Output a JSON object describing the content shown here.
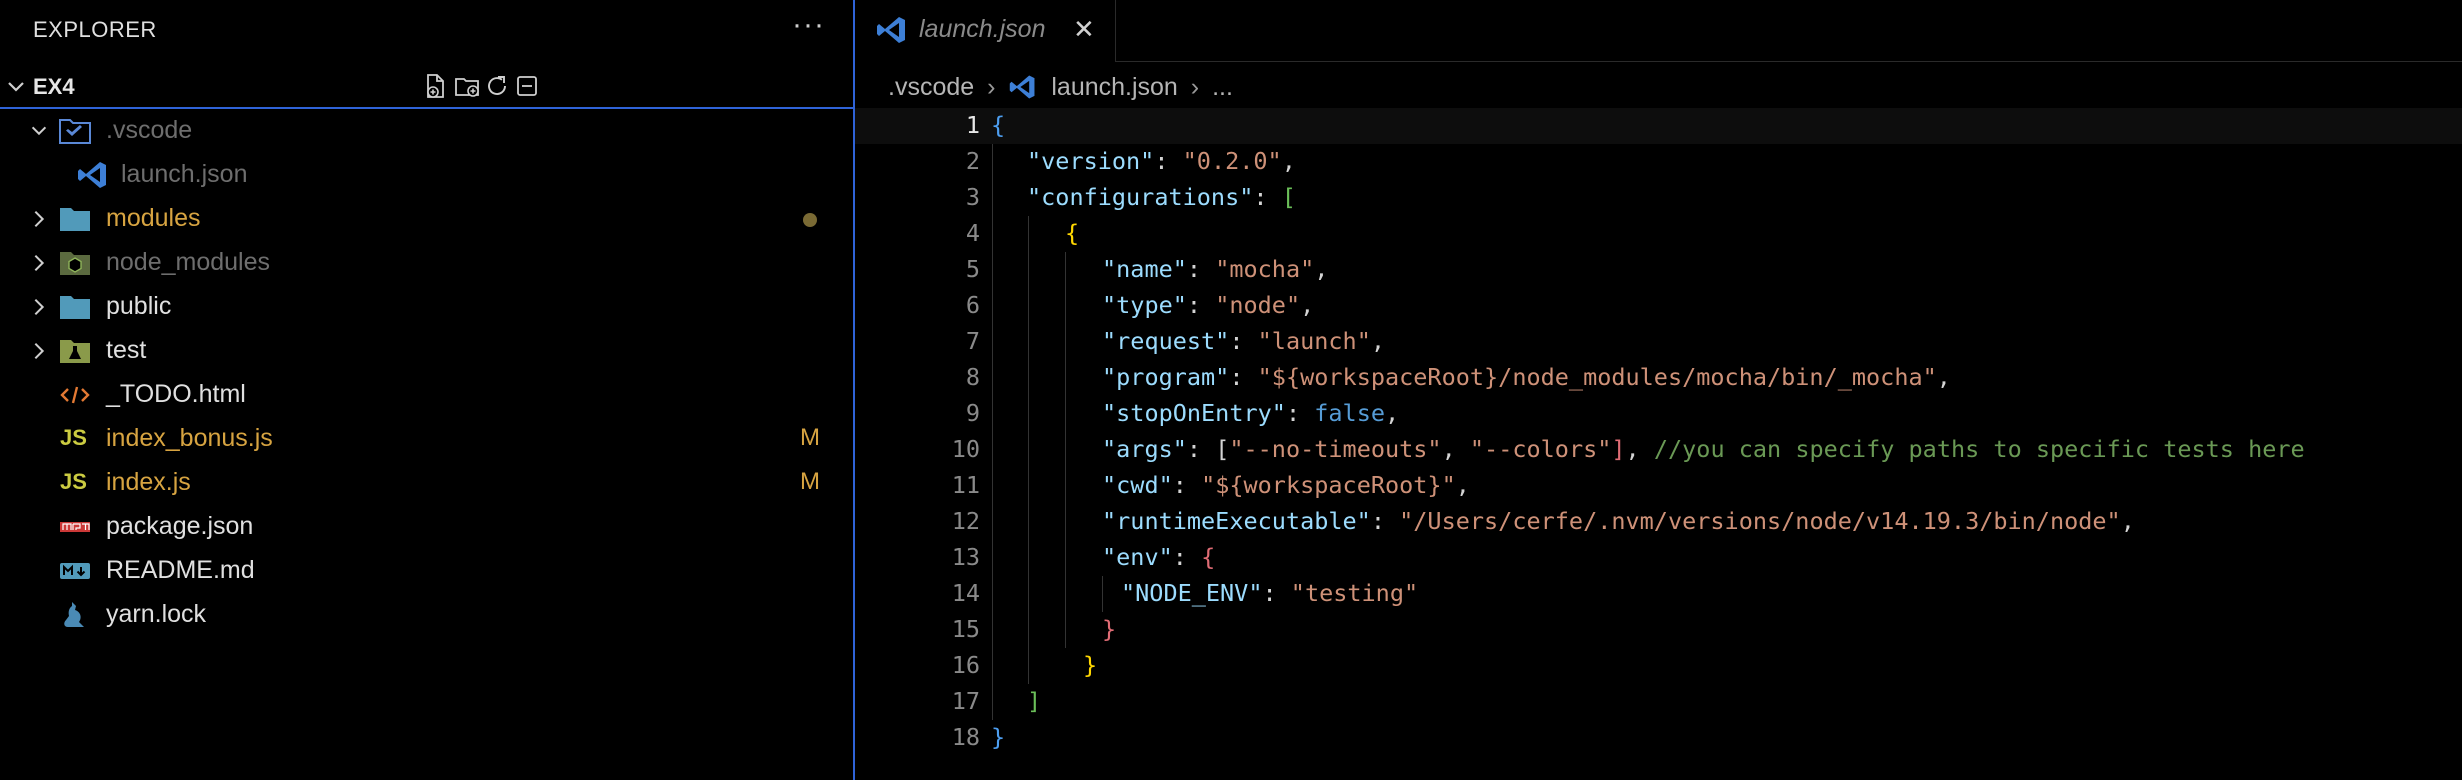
{
  "explorer": {
    "title": "EXPLORER",
    "more": "···",
    "workspace": "EX4",
    "items": [
      {
        "label": "launch.json",
        "kind": "vscode-json",
        "color": "#6e6e6e"
      },
      {
        "label": "modules",
        "kind": "folder",
        "color": "#d7a441",
        "status": "dot"
      },
      {
        "label": "node_modules",
        "kind": "node-folder",
        "color": "#6e6e6e"
      },
      {
        "label": "public",
        "kind": "folder",
        "color": "#e0e0e0"
      },
      {
        "label": "test",
        "kind": "test-folder",
        "color": "#e0e0e0"
      },
      {
        "label": "_TODO.html",
        "kind": "html",
        "color": "#e0e0e0"
      },
      {
        "label": "index_bonus.js",
        "kind": "js",
        "color": "#d7a441",
        "status": "M"
      },
      {
        "label": "index.js",
        "kind": "js",
        "color": "#d7a441",
        "status": "M"
      },
      {
        "label": "package.json",
        "kind": "npm",
        "color": "#e0e0e0"
      },
      {
        "label": "README.md",
        "kind": "markdown",
        "color": "#e0e0e0"
      },
      {
        "label": "yarn.lock",
        "kind": "yarn",
        "color": "#e0e0e0"
      }
    ],
    "vscode_folder": ".vscode"
  },
  "tab": {
    "label": "launch.json",
    "close": "✕"
  },
  "breadcrumb": {
    "folder": ".vscode",
    "file": "launch.json",
    "more": "..."
  },
  "code": {
    "line_numbers": [
      "1",
      "2",
      "3",
      "4",
      "5",
      "6",
      "7",
      "8",
      "9",
      "10",
      "11",
      "12",
      "13",
      "14",
      "15",
      "16",
      "17",
      "18"
    ],
    "lines": [
      "{",
      "\"version\": \"0.2.0\",",
      "\"configurations\": [",
      "{",
      "\"name\": \"mocha\",",
      "\"type\": \"node\",",
      "\"request\": \"launch\",",
      "\"program\": \"${workspaceRoot}/node_modules/mocha/bin/_mocha\",",
      "\"stopOnEntry\": false,",
      "\"args\": [\"--no-timeouts\", \"--colors\"], //you can specify paths to specific tests here",
      "\"cwd\": \"${workspaceRoot}\",",
      "\"runtimeExecutable\": \"/Users/cerfe/.nvm/versions/node/v14.19.3/bin/node\",",
      "\"env\": {",
      "\"NODE_ENV\": \"testing\"",
      "}",
      "}",
      "]",
      "}"
    ]
  },
  "colors": {
    "accent": "#2f63d8",
    "modified": "#d7a441",
    "folder": "#519aba"
  }
}
